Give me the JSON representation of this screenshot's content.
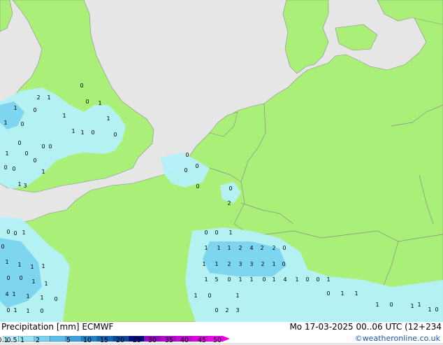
{
  "footer": {
    "title": "Precipitation [mm]  ECMWF",
    "valid_time": "Mo 17-03-2025 00..06 UTC (12+234",
    "credit": "©weatheronline.co.uk"
  },
  "legend": {
    "ticks": [
      "0.1",
      "0.5",
      "1",
      "2",
      "5",
      "10",
      "15",
      "20",
      "25",
      "30",
      "35",
      "40",
      "45",
      "50"
    ],
    "colors": [
      "#b4f0fa",
      "#96e6f5",
      "#78d2f0",
      "#5abee6",
      "#3ca0dc",
      "#1e82c8",
      "#1464b4",
      "#0a46a0",
      "#000a82",
      "#9600c8",
      "#b400d2",
      "#c800dc",
      "#dc00e6",
      "#f000f0"
    ]
  },
  "map_colors": {
    "sea": "#e6e6e6",
    "land": "#aaf078",
    "rain_light": "#b4f0fa",
    "rain_medium": "#78d2f0",
    "border": "#8c8c8c"
  },
  "values": [
    "2",
    "1",
    "1",
    "0",
    "1",
    "0",
    "0",
    "0",
    "1",
    "1",
    "0",
    "1",
    "1",
    "1",
    "0",
    "0",
    "0",
    "0",
    "1",
    "0",
    "0",
    "0",
    "0",
    "1",
    "1",
    "3",
    "0",
    "0",
    "0",
    "0",
    "0",
    "2",
    "1",
    "0",
    "0",
    "0",
    "0",
    "0",
    "1",
    "1",
    "1",
    "1",
    "2",
    "4",
    "2",
    "2",
    "0",
    "1",
    "1",
    "2",
    "3",
    "3",
    "2",
    "1",
    "0",
    "1",
    "5",
    "0",
    "1",
    "1",
    "0",
    "1",
    "4",
    "1",
    "0",
    "0",
    "1",
    "1",
    "0",
    "1",
    "0",
    "2",
    "3",
    "1",
    "1",
    "1",
    "1",
    "0",
    "0",
    "1",
    "1",
    "4",
    "1",
    "1",
    "1",
    "0",
    "0",
    "1",
    "1",
    "0",
    "0",
    "1",
    "1",
    "1",
    "0",
    "1",
    "1",
    "1",
    "0"
  ]
}
